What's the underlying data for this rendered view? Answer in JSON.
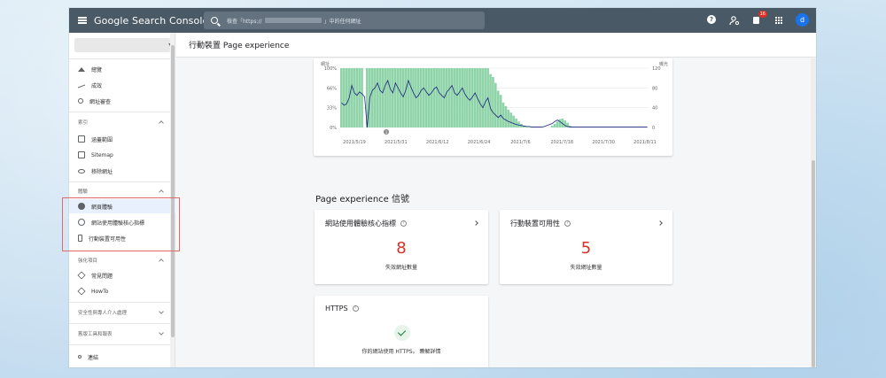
{
  "app": {
    "title": "Google Search Console",
    "search_placeholder": "檢查「https://",
    "search_placeholder_suffix": "」中的任何網址",
    "notification_count": "16",
    "avatar_letter": "d"
  },
  "sidebar": {
    "items_top": [
      {
        "label": "總覽",
        "icon": "home-icon"
      },
      {
        "label": "成效",
        "icon": "trend-icon"
      },
      {
        "label": "網址審查",
        "icon": "search-icon"
      }
    ],
    "index_section": {
      "label": "索引",
      "items": [
        {
          "label": "涵蓋範圍",
          "icon": "file-icon"
        },
        {
          "label": "Sitemap",
          "icon": "sitemap-icon"
        },
        {
          "label": "移除網址",
          "icon": "eye-off-icon"
        }
      ]
    },
    "experience_section": {
      "label": "體驗",
      "items": [
        {
          "label": "網頁體驗",
          "icon": "plus-circle-icon",
          "active": true
        },
        {
          "label": "網站使用體驗核心指標",
          "icon": "gauge-icon"
        },
        {
          "label": "行動裝置可用性",
          "icon": "phone-icon"
        }
      ]
    },
    "enhancements_section": {
      "label": "強化項目",
      "items": [
        {
          "label": "常見問題",
          "icon": "diamond-icon"
        },
        {
          "label": "HowTo",
          "icon": "diamond-icon"
        }
      ]
    },
    "security_section": {
      "label": "安全性與專人介入處理"
    },
    "legacy_section": {
      "label": "舊版工具和報表"
    },
    "links_item": {
      "label": "連結",
      "icon": "links-icon"
    }
  },
  "page": {
    "title": "行動裝置 Page experience"
  },
  "chart_data": {
    "type": "bar",
    "left_axis_label": "網址",
    "right_axis_label": "曝光",
    "left_ticks": [
      "100%",
      "66%",
      "33%",
      "0%"
    ],
    "right_ticks": [
      "120",
      "80",
      "40",
      "0"
    ],
    "x_tick_labels": [
      "2021/5/19",
      "2021/5/31",
      "2021/6/12",
      "2021/6/24",
      "2021/7/6",
      "2021/7/18",
      "2021/7/30",
      "2021/8/11"
    ],
    "annotation": "1",
    "bar_color": "#8fd4a8",
    "line_color": "#1a237e",
    "bars_pct": [
      100,
      100,
      100,
      100,
      100,
      100,
      100,
      100,
      100,
      0,
      100,
      100,
      100,
      100,
      100,
      100,
      100,
      100,
      100,
      100,
      100,
      100,
      100,
      100,
      100,
      100,
      100,
      100,
      100,
      100,
      100,
      100,
      100,
      100,
      100,
      100,
      100,
      100,
      100,
      100,
      100,
      100,
      100,
      100,
      100,
      100,
      100,
      100,
      100,
      100,
      100,
      100,
      100,
      100,
      100,
      100,
      100,
      100,
      90,
      85,
      75,
      62,
      55,
      42,
      36,
      30,
      25,
      20,
      15,
      10,
      6,
      3,
      2,
      1,
      1,
      0,
      0,
      0,
      0,
      0,
      0,
      0,
      3,
      6,
      10,
      14,
      15,
      12,
      8,
      3,
      0,
      0,
      0,
      0,
      0,
      0,
      0,
      0,
      0,
      0,
      0,
      0,
      0,
      0,
      0,
      0,
      0,
      0,
      0,
      0,
      0,
      0,
      0,
      0,
      0,
      0,
      0,
      0,
      0,
      0
    ],
    "line": [
      50,
      45,
      48,
      60,
      85,
      70,
      65,
      72,
      68,
      62,
      0,
      60,
      75,
      80,
      90,
      75,
      70,
      85,
      95,
      78,
      70,
      90,
      80,
      70,
      62,
      75,
      95,
      82,
      70,
      60,
      65,
      75,
      80,
      72,
      65,
      70,
      78,
      82,
      70,
      65,
      60,
      72,
      78,
      85,
      70,
      65,
      72,
      80,
      68,
      60,
      55,
      62,
      70,
      58,
      48,
      40,
      52,
      60,
      38,
      30,
      25,
      20,
      25,
      18,
      15,
      12,
      10,
      8,
      6,
      5,
      4,
      3,
      2,
      2,
      1,
      1,
      1,
      1,
      1,
      2,
      4,
      6,
      8,
      12,
      15,
      12,
      8,
      4,
      2,
      1,
      1,
      1,
      1,
      1,
      1,
      1,
      1,
      1,
      1,
      1,
      1,
      1,
      1,
      1,
      1,
      1,
      1,
      1,
      1,
      1,
      1,
      1,
      1,
      1,
      1,
      1,
      1,
      1,
      1,
      1
    ]
  },
  "signals": {
    "title": "Page experience 信號",
    "cwv": {
      "title": "網站使用體驗核心指標",
      "value": "8",
      "sub": "失效網址數量"
    },
    "mobile": {
      "title": "行動裝置可用性",
      "value": "5",
      "sub": "失效網址數量"
    },
    "https": {
      "title": "HTTPS",
      "sub": "你的網站使用 HTTPS。 瞭解詳情"
    }
  },
  "colors": {
    "topbar": "#4a5966",
    "error": "#d93025",
    "success": "#188038"
  }
}
